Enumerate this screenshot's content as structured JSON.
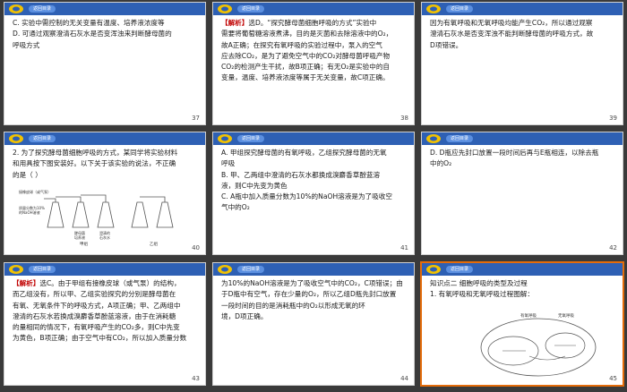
{
  "header_label": "返回目录",
  "slides": [
    {
      "num": "37",
      "lines": [
        "C. 实验中需控制的无关变量有温度、培养液浓度等",
        "D. 可通过观察澄清石灰水是否变浑浊来判断酵母菌的",
        "呼吸方式"
      ]
    },
    {
      "num": "38",
      "tag": "【解析】",
      "lines": [
        "选D。“探究酵母菌细胞呼吸的方式”实验中",
        "需要将葡萄糖溶液煮沸，目的是灭菌和去除溶液中的O₂，",
        "故A正确；在探究有氧呼吸的实验过程中，泵入的空气",
        "应去除CO₂，是为了避免空气中的CO₂对酵母菌呼吸产物",
        "CO₂的检测产生干扰，故B项正确；有无O₂是实验中的自",
        "变量，温度、培养液浓度等属于无关变量，故C项正确。"
      ]
    },
    {
      "num": "39",
      "lines": [
        "因为有氧呼吸和无氧呼吸均能产生CO₂，所以通过观察",
        "澄清石灰水是否变浑浊不能判断酵母菌的呼吸方式，故",
        "D项错误。"
      ]
    },
    {
      "num": "40",
      "lines": [
        "2. 为了探究酵母菌细胞呼吸的方式，某同学将实验材料",
        "和用具按下图安装好。以下关于该实验的说法，不正确",
        "的是（    ）"
      ],
      "fig": {
        "left": "接橡皮球（或气泵）",
        "a1": "质量分数为10%",
        "a2": "的NaOH溶液",
        "a3": "酵母菌",
        "a4": "培养液",
        "a5": "澄清的",
        "a6": "石灰水",
        "g1": "甲组",
        "g2": "乙组"
      }
    },
    {
      "num": "41",
      "lines": [
        "A. 甲组探究酵母菌的有氧呼吸，乙组探究酵母菌的无氧",
        "呼吸",
        "B. 甲、乙两组中澄清的石灰水都换成溴麝香草酚蓝溶",
        "液，则C中先变为黄色",
        "C. A瓶中加入质量分数为10%的NaOH溶液是为了吸收空",
        "气中的O₂"
      ]
    },
    {
      "num": "42",
      "lines": [
        "D. D瓶应先封口放置一段时间后再与E瓶相连，以除去瓶",
        "中的O₂"
      ]
    },
    {
      "num": "43",
      "tag": "【解析】",
      "lines": [
        "选C。由于甲组有接橡皮球（或气泵）的结构，",
        "而乙组没有，所以甲、乙组实验探究的分别是酵母菌在",
        "有氧、无氧条件下的呼吸方式，A项正确；甲、乙两组中",
        "澄清的石灰水若换成溴麝香草酚蓝溶液，由于在消耗糖",
        "的量相同的情况下，有氧呼吸产生的CO₂多，则C中先变",
        "为黄色，B项正确；由于空气中有CO₂，所以加入质量分数"
      ]
    },
    {
      "num": "44",
      "lines": [
        "为10%的NaOH溶液是为了吸收空气中的CO₂，C项错误；由",
        "于D瓶中有空气，存在少量的O₂，所以乙组D瓶先封口放置",
        "一段时间的目的是消耗瓶中的O₂以形成无氧的环",
        "境，D项正确。"
      ]
    },
    {
      "num": "45",
      "lines": [
        "知识点二   细胞呼吸的类型及过程",
        "1. 有氧呼吸和无氧呼吸过程图解："
      ],
      "fig": {
        "t1": "有氧呼吸",
        "t2": "无氧呼吸"
      }
    }
  ]
}
